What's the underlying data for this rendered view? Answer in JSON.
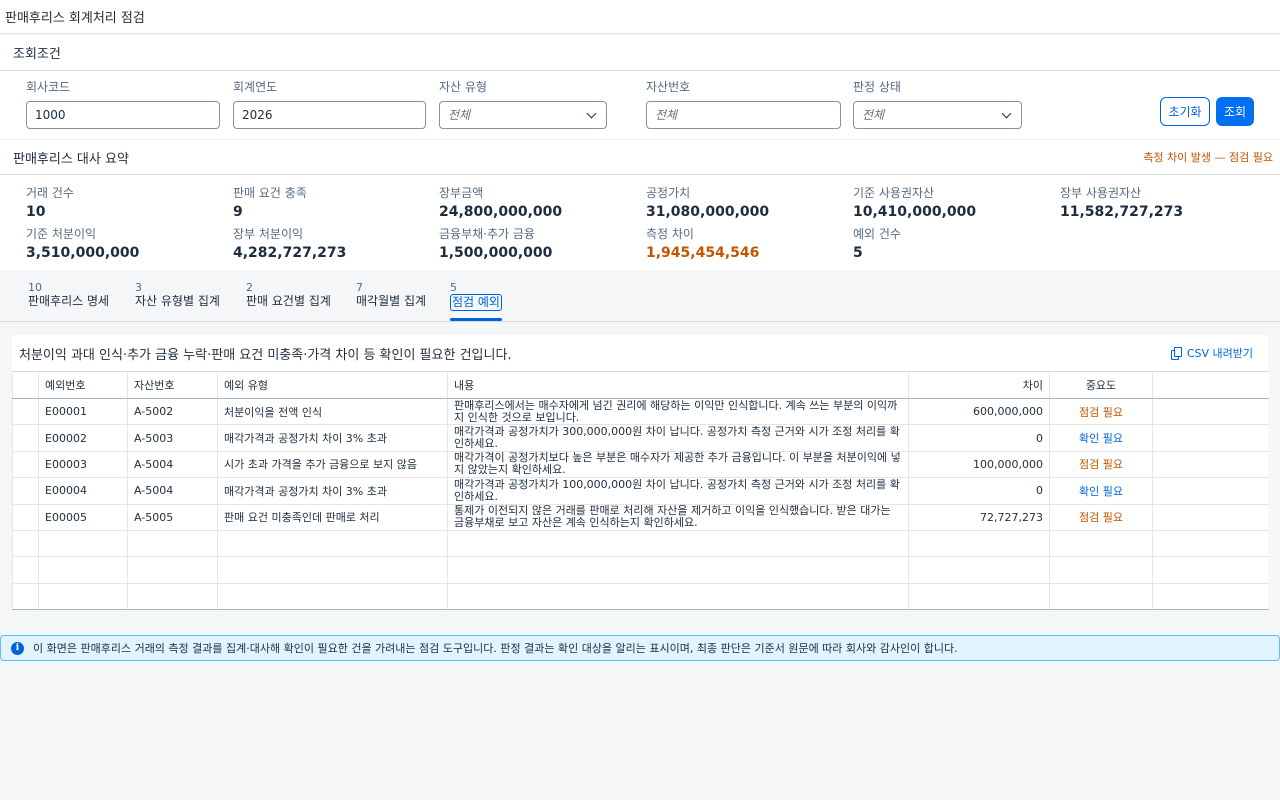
{
  "app": {
    "title": "판매후리스 회계처리 점검"
  },
  "filters": {
    "header": "조회조건",
    "company_code": {
      "label": "회사코드",
      "value": "1000"
    },
    "fiscal_year": {
      "label": "회계연도",
      "value": "2026"
    },
    "asset_type": {
      "label": "자산 유형",
      "value": "전체"
    },
    "asset_number": {
      "label": "자산번호",
      "placeholder": "전체"
    },
    "judgment_status": {
      "label": "판정 상태",
      "value": "전체"
    },
    "reset_label": "초기화",
    "search_label": "조회"
  },
  "summary": {
    "title": "판매후리스 대사 요약",
    "warning": "측정 차이 발생 — 점검 필요",
    "kpis": [
      {
        "label": "거래 건수",
        "value": "10"
      },
      {
        "label": "판매 요건 충족",
        "value": "9"
      },
      {
        "label": "장부금액",
        "value": "24,800,000,000"
      },
      {
        "label": "공정가치",
        "value": "31,080,000,000"
      },
      {
        "label": "기준 사용권자산",
        "value": "10,410,000,000"
      },
      {
        "label": "장부 사용권자산",
        "value": "11,582,727,273"
      },
      {
        "label": "기준 처분이익",
        "value": "3,510,000,000"
      },
      {
        "label": "장부 처분이익",
        "value": "4,282,727,273"
      },
      {
        "label": "금융부채·추가 금융",
        "value": "1,500,000,000"
      },
      {
        "label": "측정 차이",
        "value": "1,945,454,546"
      },
      {
        "label": "예외 건수",
        "value": "5"
      }
    ]
  },
  "tabs": [
    {
      "count": "10",
      "label": "판매후리스 명세"
    },
    {
      "count": "3",
      "label": "자산 유형별 집계"
    },
    {
      "count": "2",
      "label": "판매 요건별 집계"
    },
    {
      "count": "7",
      "label": "매각월별 집계"
    },
    {
      "count": "5",
      "label": "점검 예외"
    }
  ],
  "exceptions": {
    "description": "처분이익 과대 인식·추가 금융 누락·판매 요건 미충족·가격 차이 등 확인이 필요한 건입니다.",
    "csv_label": "CSV 내려받기",
    "columns": [
      "예외번호",
      "자산번호",
      "예외 유형",
      "내용",
      "차이",
      "중요도"
    ],
    "rows": [
      {
        "id": "E00001",
        "asset": "A-5002",
        "type": "처분이익을 전액 인식",
        "content": "판매후리스에서는 매수자에게 넘긴 권리에 해당하는 이익만 인식합니다. 계속 쓰는 부분의 이익까지 인식한 것으로 보입니다.",
        "diff": "600,000,000",
        "severity": "점검 필요"
      },
      {
        "id": "E00002",
        "asset": "A-5003",
        "type": "매각가격과 공정가치 차이 3% 초과",
        "content": "매각가격과 공정가치가 300,000,000원 차이 납니다. 공정가치 측정 근거와 시가 조정 처리를 확인하세요.",
        "diff": "0",
        "severity": "확인 필요"
      },
      {
        "id": "E00003",
        "asset": "A-5004",
        "type": "시가 초과 가격을 추가 금융으로 보지 않음",
        "content": "매각가격이 공정가치보다 높은 부분은 매수자가 제공한 추가 금융입니다. 이 부분을 처분이익에 넣지 않았는지 확인하세요.",
        "diff": "100,000,000",
        "severity": "점검 필요"
      },
      {
        "id": "E00004",
        "asset": "A-5004",
        "type": "매각가격과 공정가치 차이 3% 초과",
        "content": "매각가격과 공정가치가 100,000,000원 차이 납니다. 공정가치 측정 근거와 시가 조정 처리를 확인하세요.",
        "diff": "0",
        "severity": "확인 필요"
      },
      {
        "id": "E00005",
        "asset": "A-5005",
        "type": "판매 요건 미충족인데 판매로 처리",
        "content": "통제가 이전되지 않은 거래를 판매로 처리해 자산을 제거하고 이익을 인식했습니다. 받은 대가는 금융부채로 보고 자산은 계속 인식하는지 확인하세요.",
        "diff": "72,727,273",
        "severity": "점검 필요"
      }
    ]
  },
  "message": "이 화면은 판매후리스 거래의 측정 결과를 집계·대사해 확인이 필요한 건을 가려내는 점검 도구입니다. 판정 결과는 확인 대상을 알리는 표시이며, 최종 판단은 기준서 원문에 따라 회사와 감사인이 합니다."
}
